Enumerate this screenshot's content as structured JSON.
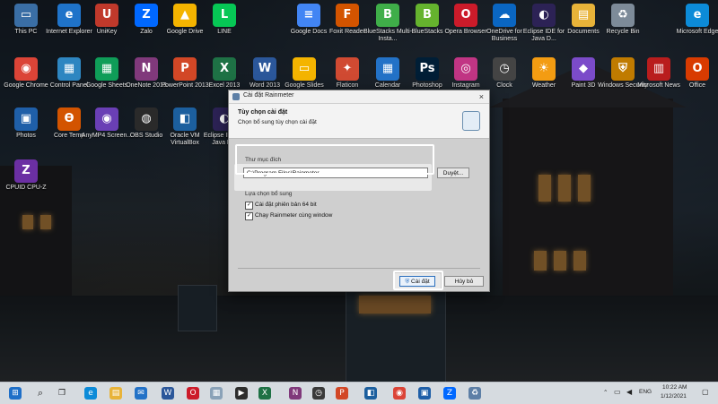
{
  "desktop": {
    "icons": [
      {
        "label": "This PC",
        "glyph": "▭",
        "color": "#3a6ea5"
      },
      {
        "label": "Internet Explorer",
        "glyph": "e",
        "color": "#1f73c9"
      },
      {
        "label": "UniKey",
        "glyph": "U",
        "color": "#c0392b"
      },
      {
        "label": "Zalo",
        "glyph": "Z",
        "color": "#0068ff"
      },
      {
        "label": "Google Drive",
        "glyph": "▲",
        "color": "#f4b400"
      },
      {
        "label": "LINE",
        "glyph": "L",
        "color": "#06c755"
      },
      {
        "label": "Google Docs",
        "glyph": "≡",
        "color": "#4285f4"
      },
      {
        "label": "Foxit Reader",
        "glyph": "F",
        "color": "#d35400"
      },
      {
        "label": "BlueStacks Multi-Insta...",
        "glyph": "B",
        "color": "#3fae49"
      },
      {
        "label": "BlueStacks",
        "glyph": "B",
        "color": "#65b32e"
      },
      {
        "label": "Opera Browser",
        "glyph": "O",
        "color": "#cc1b2a"
      },
      {
        "label": "OneDrive for Business",
        "glyph": "☁",
        "color": "#0a66c2"
      },
      {
        "label": "Eclipse IDE for Java D...",
        "glyph": "◐",
        "color": "#2c2255"
      },
      {
        "label": "Documents",
        "glyph": "▤",
        "color": "#e8b339"
      },
      {
        "label": "Recycle Bin",
        "glyph": "♻",
        "color": "#7d8b99"
      },
      {
        "label": "Microsoft Edge",
        "glyph": "e",
        "color": "#0c8bd8"
      },
      {
        "label": "Google Chrome",
        "glyph": "◉",
        "color": "#db4437"
      },
      {
        "label": "Control Panel",
        "glyph": "▦",
        "color": "#2e86c1"
      },
      {
        "label": "Google Sheets",
        "glyph": "▦",
        "color": "#0f9d58"
      },
      {
        "label": "OneNote 2013",
        "glyph": "N",
        "color": "#80397b"
      },
      {
        "label": "PowerPoint 2013",
        "glyph": "P",
        "color": "#d24726"
      },
      {
        "label": "Excel 2013",
        "glyph": "X",
        "color": "#1e7145"
      },
      {
        "label": "Word 2013",
        "glyph": "W",
        "color": "#2b579a"
      },
      {
        "label": "Google Slides",
        "glyph": "▭",
        "color": "#f4b400"
      },
      {
        "label": "Flaticon",
        "glyph": "✦",
        "color": "#d04a32"
      },
      {
        "label": "Calendar",
        "glyph": "▦",
        "color": "#2372c7"
      },
      {
        "label": "Photoshop",
        "glyph": "Ps",
        "color": "#001e36"
      },
      {
        "label": "Instagram",
        "glyph": "◎",
        "color": "#c13584"
      },
      {
        "label": "Clock",
        "glyph": "◷",
        "color": "#444"
      },
      {
        "label": "Weather",
        "glyph": "☀",
        "color": "#f39c12"
      },
      {
        "label": "Paint 3D",
        "glyph": "◆",
        "color": "#7b4bc9"
      },
      {
        "label": "Windows Security",
        "glyph": "⛨",
        "color": "#c07b00"
      },
      {
        "label": "Microsoft News",
        "glyph": "▥",
        "color": "#b91d1d"
      },
      {
        "label": "Office",
        "glyph": "O",
        "color": "#d83b01"
      },
      {
        "label": "Photos",
        "glyph": "▣",
        "color": "#1f5fa8"
      },
      {
        "label": "Core Temp",
        "glyph": "ϴ",
        "color": "#d35400"
      },
      {
        "label": "AnyMP4 Screen...",
        "glyph": "◉",
        "color": "#6a3fb5"
      },
      {
        "label": "OBS Studio",
        "glyph": "◍",
        "color": "#2a2a2a"
      },
      {
        "label": "Oracle VM VirtualBox",
        "glyph": "◧",
        "color": "#1c5f9e"
      },
      {
        "label": "Eclipse IDE for Java D...",
        "glyph": "◐",
        "color": "#2c2255"
      },
      {
        "label": "CPUID CPU-Z",
        "glyph": "Z",
        "color": "#6b2fa3"
      }
    ]
  },
  "dialog": {
    "title": "Cài đặt Rainmeter",
    "close": "×",
    "header_title": "Tùy chọn cài đặt",
    "header_subtitle": "Chọn bổ sung tùy chọn cài đặt",
    "folder_group": "Thư mục đích",
    "install_path": "C:\\Program Files\\Rainmeter",
    "browse": "Duyệt...",
    "extra_group": "Lựa chọn bổ sung",
    "options": [
      {
        "label": "Cài đặt phiên bản 64 bit",
        "checked": true
      },
      {
        "label": "Chạy Rainmeter cùng window",
        "checked": true
      }
    ],
    "install_button": "Cài đặt",
    "cancel_button": "Hủy bỏ"
  },
  "taskbar": {
    "search_glyph": "⌕",
    "language": "ENG",
    "time": "10:22 AM",
    "date": "1/12/2021"
  }
}
